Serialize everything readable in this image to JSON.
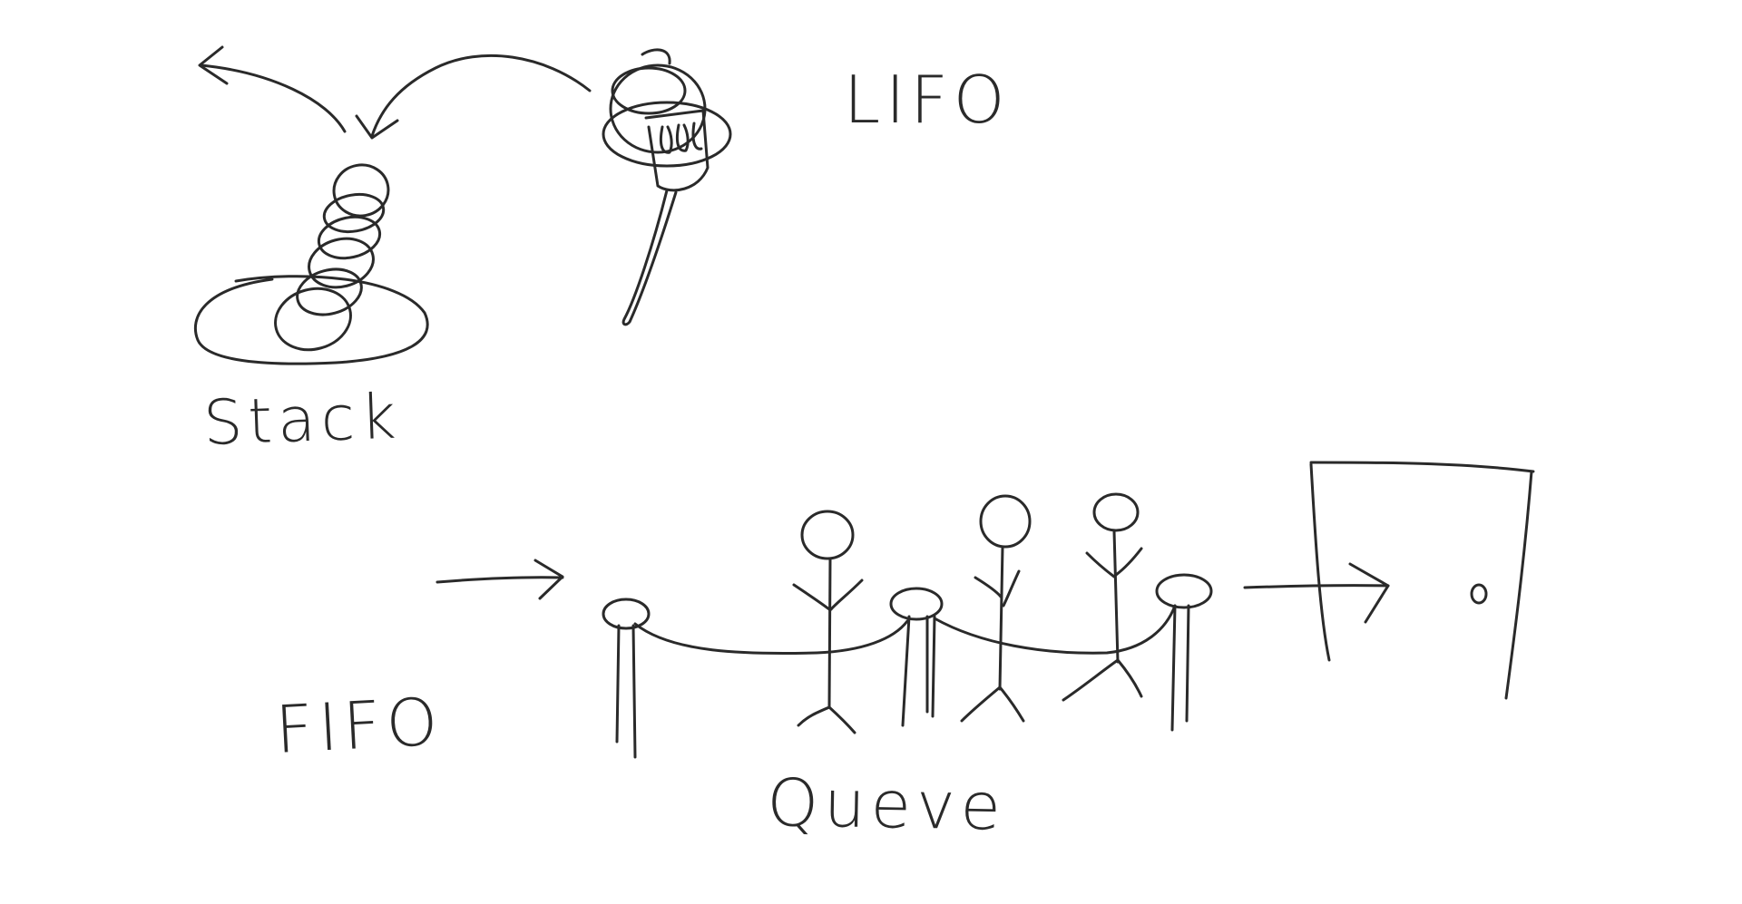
{
  "labels": {
    "lifo": "LIFO",
    "stack": "Stack",
    "fifo": "FIFO",
    "queue": "Queve"
  },
  "colors": {
    "ink": "#2a2a2a",
    "background": "#ffffff"
  },
  "icons": [
    "plate-icon",
    "pancake-stack-icon",
    "fork-icon",
    "person-icon",
    "stanchion-icon",
    "velvet-rope-icon",
    "door-icon",
    "arrow-icon"
  ]
}
